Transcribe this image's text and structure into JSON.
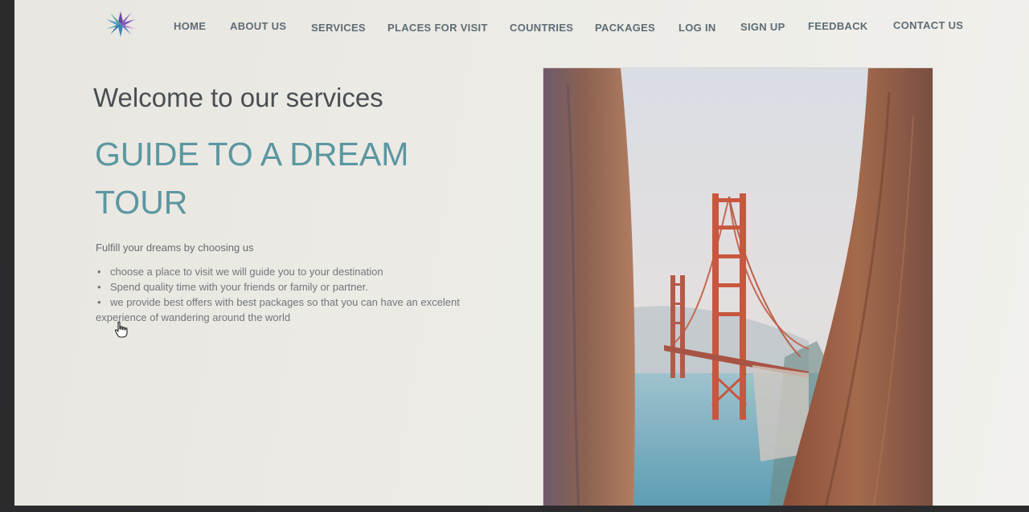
{
  "nav": {
    "items": [
      {
        "label": "HOME"
      },
      {
        "label": "ABOUT US"
      },
      {
        "label": "SERVICES"
      },
      {
        "label": "PLACES FOR VISIT"
      },
      {
        "label": "COUNTRIES"
      },
      {
        "label": "PACKAGES"
      },
      {
        "label": "LOG IN"
      },
      {
        "label": "SIGN UP"
      },
      {
        "label": "FEEDBACK"
      },
      {
        "label": "CONTACT US"
      }
    ]
  },
  "hero": {
    "welcome": "Welcome to our services",
    "headline": "GUIDE TO A DREAM TOUR",
    "intro": "Fulfill your dreams by choosing us",
    "bullets": [
      "choose a place to visit we will guide you to your destination",
      "Spend quality time with your friends or family or partner.",
      "we provide best offers with best packages so that you can have an excelent"
    ],
    "bullet_continuation": "experience of wandering around the world"
  },
  "icons": {
    "logo": "star-burst-logo-icon",
    "cursor": "hand-pointer-cursor-icon",
    "bullet": "•"
  },
  "colors": {
    "headline": "#5b97a0",
    "nav_text": "#5e6c74",
    "page_background": "#ecebe6"
  }
}
